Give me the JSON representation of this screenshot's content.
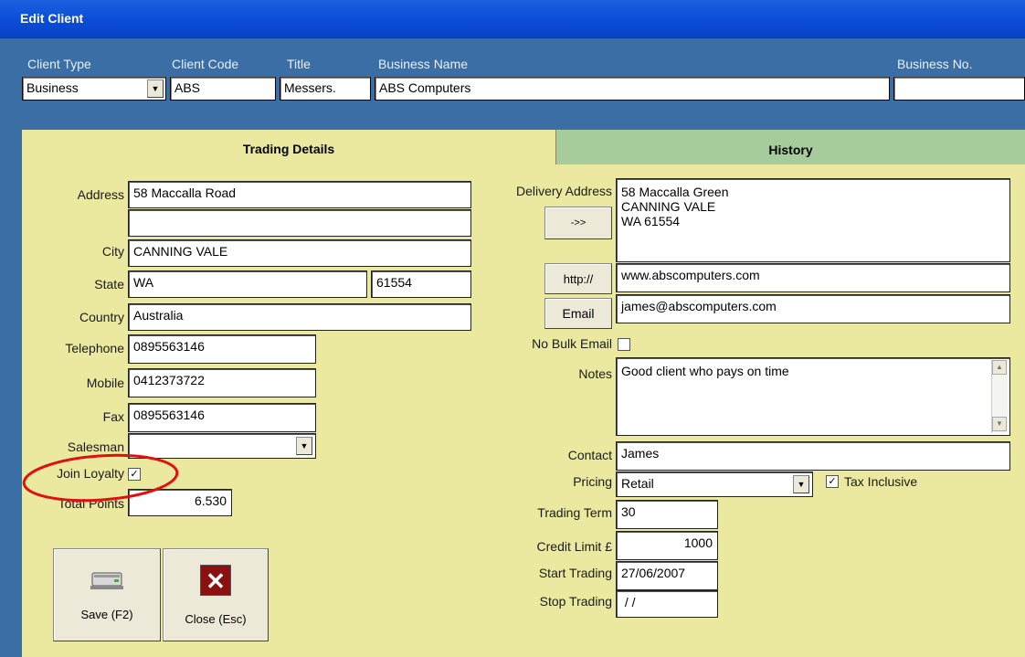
{
  "window": {
    "title": "Edit Client"
  },
  "header": {
    "client_type_label": "Client Type",
    "client_code_label": "Client Code",
    "title_label": "Title",
    "business_name_label": "Business Name",
    "business_no_label": "Business No.",
    "client_type_value": "Business",
    "client_code_value": "ABS",
    "title_value": "Messers.",
    "business_name_value": "ABS Computers",
    "business_no_value": ""
  },
  "tabs": {
    "trading_details": "Trading Details",
    "history": "History"
  },
  "left": {
    "address_label": "Address",
    "address_line1": "58 Maccalla Road",
    "address_line2": "",
    "city_label": "City",
    "city_value": "CANNING VALE",
    "state_label": "State",
    "state_value": "WA",
    "postcode_value": "61554",
    "country_label": "Country",
    "country_value": "Australia",
    "telephone_label": "Telephone",
    "telephone_value": "0895563146",
    "mobile_label": "Mobile",
    "mobile_value": "0412373722",
    "fax_label": "Fax",
    "fax_value": "0895563146",
    "salesman_label": "Salesman",
    "salesman_value": "",
    "join_loyalty_label": "Join Loyalty",
    "join_loyalty_checked": true,
    "total_points_label": "Total Points",
    "total_points_value": "6.530"
  },
  "right": {
    "delivery_address_label": "Delivery Address",
    "delivery_address_value": "58 Maccalla Green\nCANNING VALE\nWA  61554",
    "copy_address_button": "->>",
    "http_button": "http://",
    "website_value": "www.abscomputers.com",
    "email_button": "Email",
    "email_value": "james@abscomputers.com",
    "no_bulk_email_label": "No Bulk Email",
    "no_bulk_email_checked": false,
    "notes_label": "Notes",
    "notes_value": "Good client who pays on time",
    "contact_label": "Contact",
    "contact_value": "James",
    "pricing_label": "Pricing",
    "pricing_value": "Retail",
    "tax_inclusive_label": "Tax Inclusive",
    "tax_inclusive_checked": true,
    "trading_term_label": "Trading Term",
    "trading_term_value": "30",
    "credit_limit_label": "Credit Limit £",
    "credit_limit_value": "1000",
    "start_trading_label": "Start Trading",
    "start_trading_value": "27/06/2007",
    "stop_trading_label": "Stop Trading",
    "stop_trading_value": " / /"
  },
  "buttons": {
    "save": "Save (F2)",
    "close": "Close (Esc)"
  },
  "icons": {
    "save": "keyboard-icon",
    "close": "close-x-icon",
    "dropdown": "chevron-down-icon"
  },
  "colors": {
    "panel": "#ebe9a0",
    "history_tab": "#a7cc9c",
    "title_bar": "#0a4bd6",
    "annotation": "#e01010",
    "close_icon_bg": "#8b1010"
  }
}
